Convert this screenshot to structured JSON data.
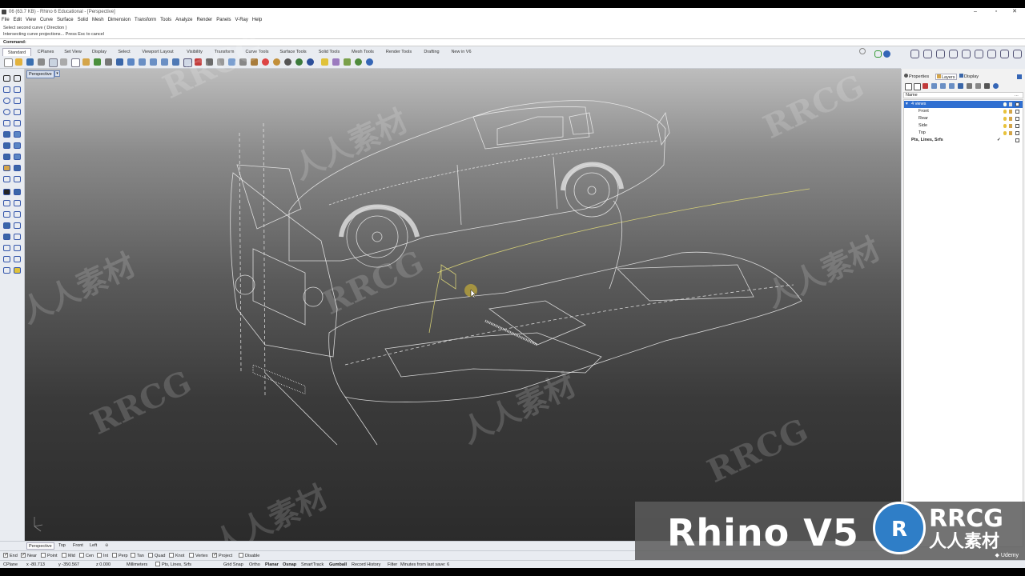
{
  "titlebar": {
    "title": "06 (63.7 KB) - Rhino 6 Educational - [Perspective]"
  },
  "menubar": {
    "items": [
      "File",
      "Edit",
      "View",
      "Curve",
      "Surface",
      "Solid",
      "Mesh",
      "Dimension",
      "Transform",
      "Tools",
      "Analyze",
      "Render",
      "Panels",
      "V-Ray",
      "Help"
    ]
  },
  "command_history": [
    "Select second curve ( Direction )",
    "Intersecting curve projections... Press Esc to cancel"
  ],
  "command": {
    "label": "Command:",
    "value": ""
  },
  "toolbar_tabs": [
    "Standard",
    "CPlanes",
    "Set View",
    "Display",
    "Select",
    "Viewport Layout",
    "Visibility",
    "Transform",
    "Curve Tools",
    "Surface Tools",
    "Solid Tools",
    "Mesh Tools",
    "Render Tools",
    "Drafting",
    "New in V6"
  ],
  "viewport": {
    "label": "Perspective",
    "dropdown_icon": "chevron-down-icon"
  },
  "viewport_tabs": [
    "Perspective",
    "Top",
    "Front",
    "Left"
  ],
  "panel": {
    "tabs": [
      "Properties",
      "Layers",
      "Display"
    ],
    "column_header": "Name",
    "layers": [
      {
        "name": "4 views",
        "selected": true,
        "indent": 1,
        "color": "#ffffff"
      },
      {
        "name": "Front",
        "selected": false,
        "indent": 2,
        "color": "#ffffff"
      },
      {
        "name": "Rear",
        "selected": false,
        "indent": 2,
        "color": "#ffffff"
      },
      {
        "name": "Side",
        "selected": false,
        "indent": 2,
        "color": "#ffffff"
      },
      {
        "name": "Top",
        "selected": false,
        "indent": 2,
        "color": "#ffffff"
      },
      {
        "name": "Pts, Lines, Srfs",
        "selected": false,
        "indent": 0,
        "color": "#ffffff",
        "current": true
      }
    ]
  },
  "osnaps": [
    {
      "label": "End",
      "checked": true
    },
    {
      "label": "Near",
      "checked": true
    },
    {
      "label": "Point",
      "checked": false
    },
    {
      "label": "Mid",
      "checked": false
    },
    {
      "label": "Cen",
      "checked": false
    },
    {
      "label": "Int",
      "checked": false
    },
    {
      "label": "Perp",
      "checked": false
    },
    {
      "label": "Tan",
      "checked": false
    },
    {
      "label": "Quad",
      "checked": false
    },
    {
      "label": "Knot",
      "checked": false
    },
    {
      "label": "Vertex",
      "checked": false
    },
    {
      "label": "Project",
      "checked": true
    },
    {
      "label": "Disable",
      "checked": false
    }
  ],
  "statusbar": {
    "cplane": "CPlane",
    "x": "x -80.713",
    "y": "y -350.567",
    "z": "z 0.000",
    "units": "Millimeters",
    "layer": "Pts, Lines, Srfs",
    "toggles": [
      "Grid Snap",
      "Ortho",
      "Planar",
      "Osnap",
      "SmartTrack",
      "Gumball",
      "Record History",
      "Filter"
    ],
    "bold_toggles": [
      "Planar",
      "Osnap",
      "Gumball"
    ],
    "save_info": "Minutes from last save: 6"
  },
  "overlay": {
    "title": "Rhino V5",
    "brand": "RRCG",
    "brand_cn": "人人素材",
    "platform": "Udemy"
  },
  "watermarks": [
    "RRCG",
    "人人素材"
  ],
  "colors": {
    "viewport_top": "#bdbdbd",
    "viewport_bottom": "#2b2b2b",
    "selection": "#2f6fd1",
    "wireframe": "#f0f0f0",
    "highlight": "#e8e07a"
  }
}
